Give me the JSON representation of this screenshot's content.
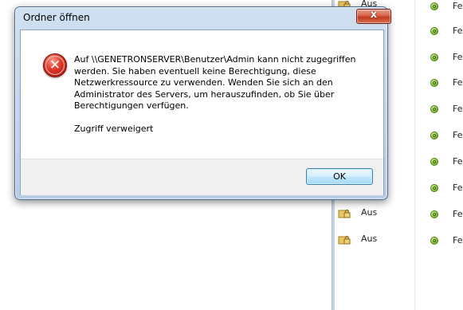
{
  "dialog": {
    "title": "Ordner öffnen",
    "close_label": "x",
    "message": "Auf \\\\GENETRONSERVER\\Benutzer\\Admin kann nicht zugegriffen\nwerden. Sie haben eventuell keine Berechtigung, diese\nNetzwerkressource zu verwenden. Wenden Sie sich an den\nAdministrator des Servers, um herauszufinden, ob Sie über\nBerechtigungen verfügen.",
    "detail": "Zugriff verweigert",
    "ok_label": "OK",
    "icon": "error-icon"
  },
  "background": {
    "lock_rows": [
      {
        "label": "Aus"
      },
      {
        "label": "Aus"
      },
      {
        "label": "Aus"
      }
    ],
    "status_rows": [
      {
        "label": "Fe"
      },
      {
        "label": "Fe"
      },
      {
        "label": "Fe"
      },
      {
        "label": "Fe"
      },
      {
        "label": "Fe"
      },
      {
        "label": "Fe"
      },
      {
        "label": "Fe"
      },
      {
        "label": "Fe"
      },
      {
        "label": "Fe"
      },
      {
        "label": "Fe"
      }
    ]
  },
  "colors": {
    "close_button": "#c8462a",
    "error_icon": "#d42d1f",
    "status_dot": "#7fbf2a",
    "ok_button_border": "#3c7fb1"
  }
}
